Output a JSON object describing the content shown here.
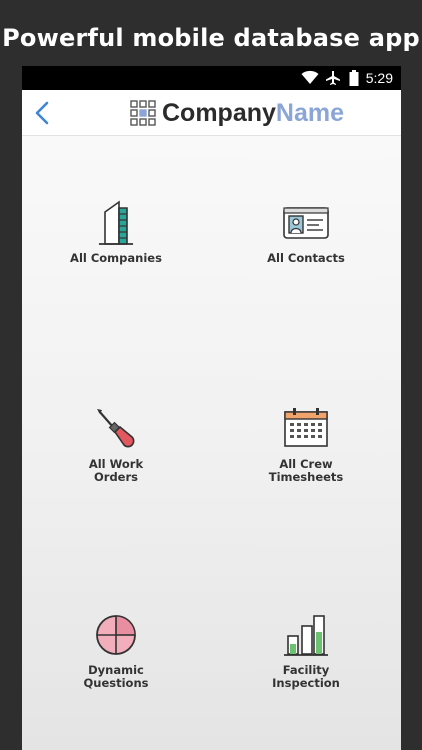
{
  "headline": "Powerful mobile database app",
  "status_bar": {
    "time": "5:29",
    "icons": [
      "wifi-icon",
      "airplane-mode-icon",
      "battery-icon"
    ]
  },
  "app_bar": {
    "back_icon": "chevron-left-icon",
    "logo_icon": "grid-logo-icon",
    "brand_part1": "Company",
    "brand_part2": "Name"
  },
  "tiles": [
    {
      "label": "All Companies",
      "icon": "building-icon"
    },
    {
      "label": "All Contacts",
      "icon": "id-card-icon"
    },
    {
      "label": "All Work\nOrders",
      "icon": "screwdriver-icon"
    },
    {
      "label": "All Crew\nTimesheets",
      "icon": "calendar-icon"
    },
    {
      "label": "Dynamic\nQuestions",
      "icon": "pie-globe-icon"
    },
    {
      "label": "Facility\nInspection",
      "icon": "bar-chart-icon"
    }
  ],
  "colors": {
    "accent_blue": "#3f86d6",
    "brand_light": "#8aa5d6",
    "icon_stroke": "#333333",
    "teal": "#2aa59a",
    "red": "#e3585f",
    "pink": "#f3aebc",
    "green": "#6cc26e",
    "orange": "#f0a36a"
  }
}
